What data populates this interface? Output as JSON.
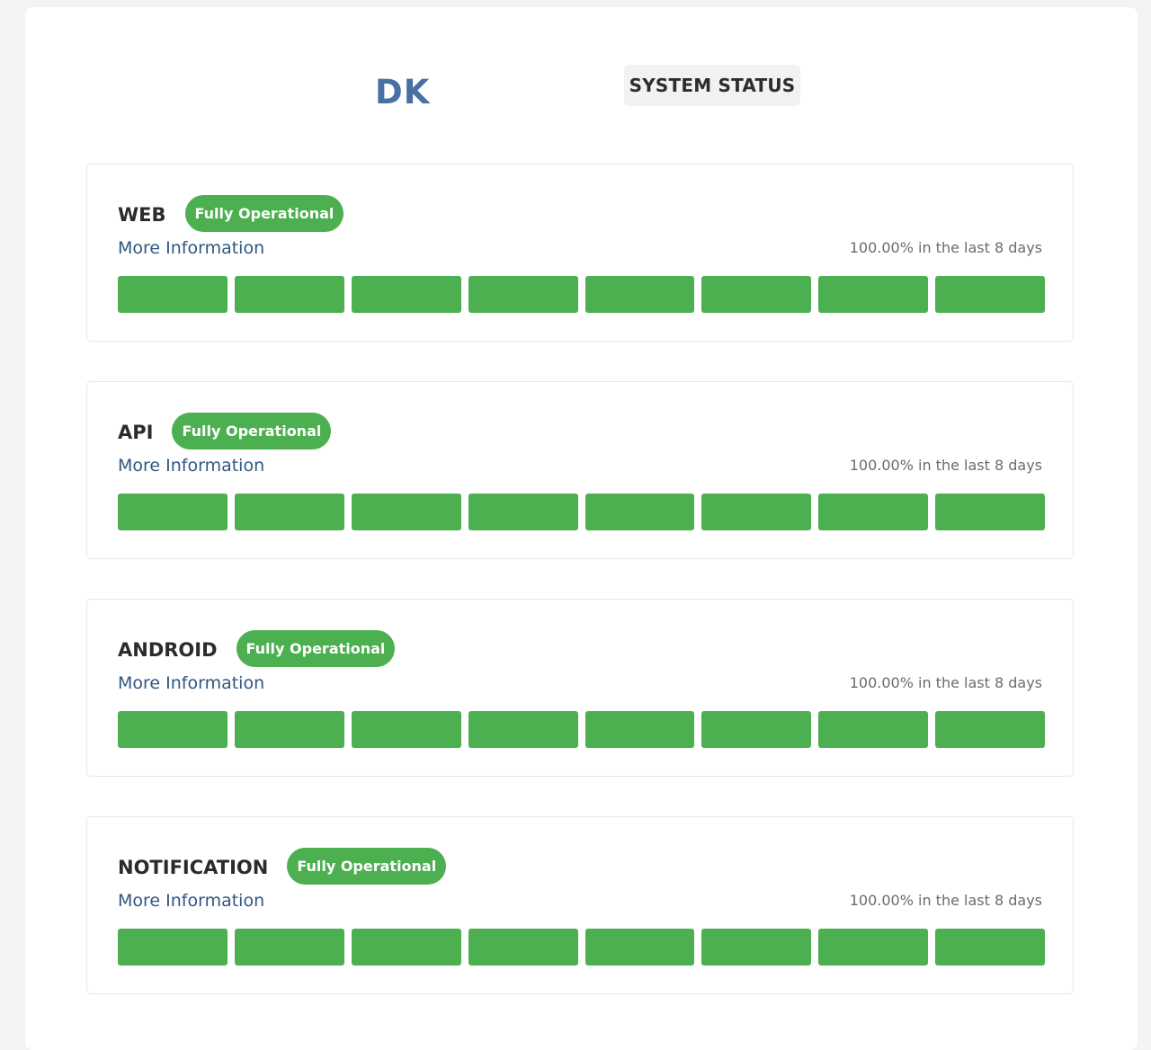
{
  "header": {
    "logo_text": "DK",
    "title": "SYSTEM STATUS"
  },
  "colors": {
    "accent_green": "#4caf50",
    "logo_blue": "#4a6fa5",
    "link_blue": "#2f5782"
  },
  "services": [
    {
      "name": "WEB",
      "status": "Fully Operational",
      "link": "More Information",
      "uptime": "100.00% in the last 8 days",
      "days": [
        "operational",
        "operational",
        "operational",
        "operational",
        "operational",
        "operational",
        "operational",
        "operational"
      ]
    },
    {
      "name": "API",
      "status": "Fully Operational",
      "link": "More Information",
      "uptime": "100.00% in the last 8 days",
      "days": [
        "operational",
        "operational",
        "operational",
        "operational",
        "operational",
        "operational",
        "operational",
        "operational"
      ]
    },
    {
      "name": "ANDROID",
      "status": "Fully Operational",
      "link": "More Information",
      "uptime": "100.00% in the last 8 days",
      "days": [
        "operational",
        "operational",
        "operational",
        "operational",
        "operational",
        "operational",
        "operational",
        "operational"
      ]
    },
    {
      "name": "NOTIFICATION",
      "status": "Fully Operational",
      "link": "More Information",
      "uptime": "100.00% in the last 8 days",
      "days": [
        "operational",
        "operational",
        "operational",
        "operational",
        "operational",
        "operational",
        "operational",
        "operational"
      ]
    }
  ]
}
